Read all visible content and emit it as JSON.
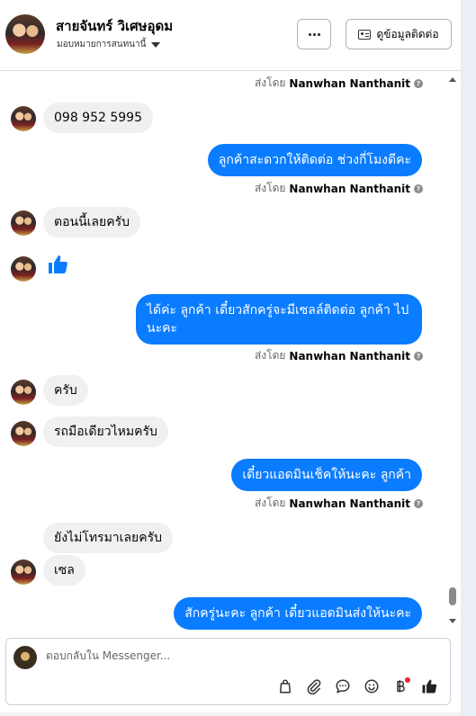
{
  "header": {
    "contact_name": "สายจันทร์ วิเศษอุดม",
    "assign_label": "มอบหมายการสนทนานี้",
    "view_contact_label": "ดูข้อมูลติดต่อ"
  },
  "colors": {
    "sent_bubble": "#0a7cff",
    "received_bubble": "#f0f0f0",
    "accent": "#0a7cff"
  },
  "messages": [
    {
      "type": "sent_by",
      "prefix": "ส่งโดย",
      "name": "Nanwhan Nanthanit"
    },
    {
      "type": "received",
      "text": "098 952 5995"
    },
    {
      "type": "sent",
      "text": "ลูกค้าสะดวกให้ติดต่อ ช่วงกี่โมงดีคะ"
    },
    {
      "type": "sent_by",
      "prefix": "ส่งโดย",
      "name": "Nanwhan Nanthanit"
    },
    {
      "type": "received",
      "text": "ตอนนี้เลยครับ"
    },
    {
      "type": "received_like",
      "icon": "thumbs-up-icon"
    },
    {
      "type": "sent",
      "text": "ได้ค่ะ  ลูกค้า เดี๋ยวสักครู่จะมีเซลล์ติดต่อ ลูกค้า ไปนะคะ"
    },
    {
      "type": "sent_by",
      "prefix": "ส่งโดย",
      "name": "Nanwhan Nanthanit"
    },
    {
      "type": "received",
      "text": "ครับ"
    },
    {
      "type": "received",
      "text": "รถมือเดียวไหมครับ"
    },
    {
      "type": "sent",
      "text": "เดี๋ยวแอดมินเช็คให้นะคะ  ลูกค้า"
    },
    {
      "type": "sent_by",
      "prefix": "ส่งโดย",
      "name": "Nanwhan Nanthanit"
    },
    {
      "type": "received",
      "text": "ยังไม่โทรมาเลยครับ"
    },
    {
      "type": "received",
      "text": "เซล"
    },
    {
      "type": "sent",
      "text": "สักครู่นะคะ  ลูกค้า เดี๋ยวแอดมินส่งให้นะคะ"
    }
  ],
  "composer": {
    "placeholder": "ตอบกลับใน Messenger...",
    "tools": [
      "shopping-bag-icon",
      "attachment-icon",
      "quick-reply-icon",
      "emoji-icon",
      "baht-icon",
      "thumbs-up-icon"
    ]
  }
}
